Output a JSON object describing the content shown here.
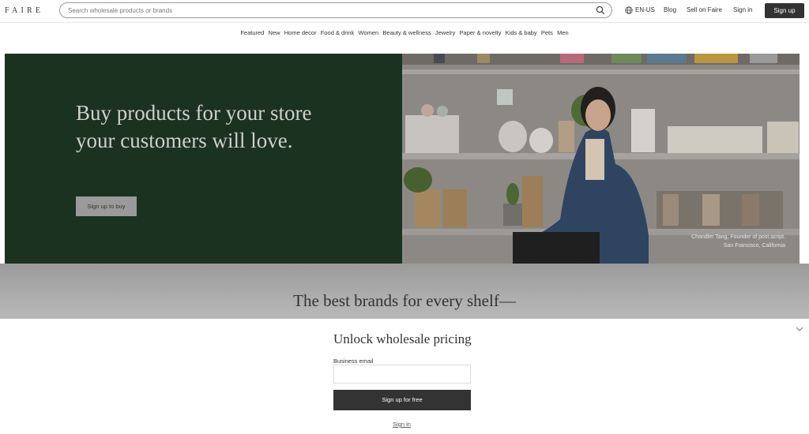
{
  "header": {
    "logo": "FAIRE",
    "search_placeholder": "Search wholesale products or brands",
    "locale": "EN-US",
    "blog": "Blog",
    "sell": "Sell on Faire",
    "signin": "Sign in",
    "signup": "Sign up"
  },
  "categories": [
    "Featured",
    "New",
    "Home decor",
    "Food & drink",
    "Women",
    "Beauty & wellness",
    "Jewelry",
    "Paper & novelty",
    "Kids & baby",
    "Pets",
    "Men"
  ],
  "hero": {
    "title": "Buy products for your store your customers will love.",
    "cta": "Sign up to buy",
    "caption_line1": "Chandler Tang, Founder of post.script.",
    "caption_line2": "San Francisco, California",
    "panel_color": "#1b3220"
  },
  "brands": {
    "title": "The best brands for every shelf—"
  },
  "modal": {
    "title": "Unlock wholesale pricing",
    "email_label": "Business email",
    "submit": "Sign up for free",
    "signin": "Sign in"
  },
  "colors": {
    "dark": "#333333",
    "hero_green": "#1b3220"
  }
}
